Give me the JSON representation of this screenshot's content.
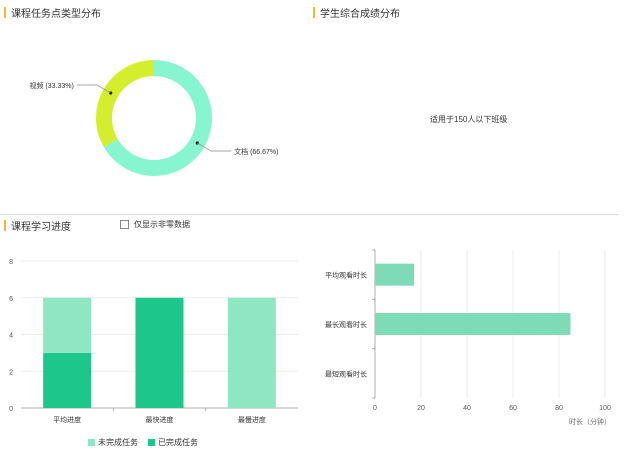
{
  "sections": {
    "task_type": "课程任务点类型分布",
    "score_dist": "学生综合成绩分布",
    "progress": "课程学习进度"
  },
  "score_note": "适用于150人以下班级",
  "checkbox_label": "仅显示非零数据",
  "colors": {
    "accent": "#f0b830",
    "light_green": "#8ee6c3",
    "dark_green": "#1dc68a",
    "lime": "#d4ee2e",
    "mint": "#87f5d0",
    "hbar": "#7edbb8"
  },
  "chart_data": [
    {
      "type": "pie",
      "variant": "donut",
      "slices": [
        {
          "label": "文档 (66.67%)",
          "name": "文档",
          "value": 66.67,
          "color": "#87f5d0"
        },
        {
          "label": "视频 (33.33%)",
          "name": "视频",
          "value": 33.33,
          "color": "#d4ee2e"
        }
      ]
    },
    {
      "type": "bar",
      "stacked": true,
      "categories": [
        "平均进度",
        "最快进度",
        "最慢进度"
      ],
      "series": [
        {
          "name": "已完成任务",
          "values": [
            3,
            6,
            0
          ],
          "color": "#1dc68a"
        },
        {
          "name": "未完成任务",
          "values": [
            3,
            0,
            6
          ],
          "color": "#8ee6c3"
        }
      ],
      "yticks": [
        "0",
        "2",
        "4",
        "6",
        "8"
      ],
      "ylim": [
        0,
        8
      ],
      "legend": [
        "未完成任务",
        "已完成任务"
      ],
      "grid": true
    },
    {
      "type": "bar",
      "orientation": "horizontal",
      "categories": [
        "平均观看时长",
        "最长观看时长",
        "最短观看时长"
      ],
      "values": [
        17,
        85,
        0
      ],
      "xticks": [
        "0",
        "20",
        "40",
        "60",
        "80",
        "100"
      ],
      "xlim": [
        0,
        100
      ],
      "xlabel": "时长（分钟）",
      "grid": true
    }
  ]
}
